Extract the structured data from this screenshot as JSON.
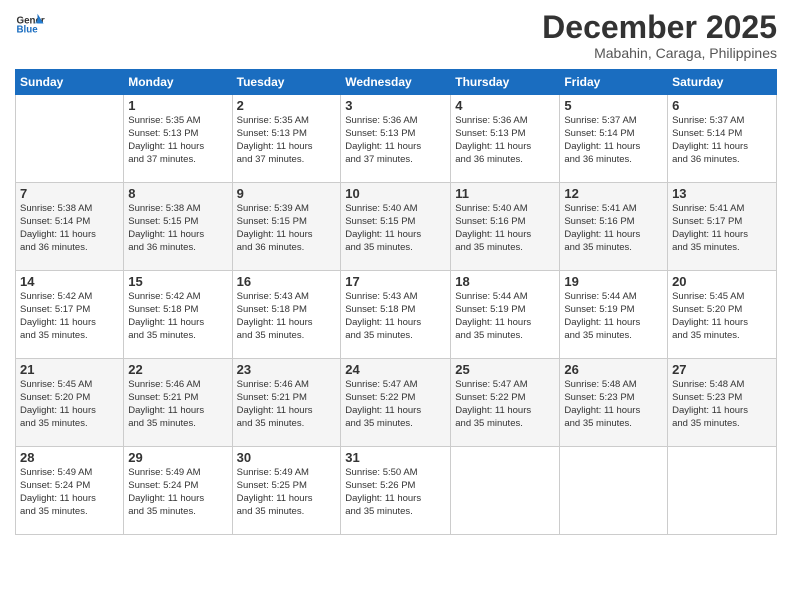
{
  "logo": {
    "general": "General",
    "blue": "Blue"
  },
  "header": {
    "month": "December 2025",
    "location": "Mabahin, Caraga, Philippines"
  },
  "weekdays": [
    "Sunday",
    "Monday",
    "Tuesday",
    "Wednesday",
    "Thursday",
    "Friday",
    "Saturday"
  ],
  "weeks": [
    [
      {
        "day": "",
        "info": ""
      },
      {
        "day": "1",
        "info": "Sunrise: 5:35 AM\nSunset: 5:13 PM\nDaylight: 11 hours\nand 37 minutes."
      },
      {
        "day": "2",
        "info": "Sunrise: 5:35 AM\nSunset: 5:13 PM\nDaylight: 11 hours\nand 37 minutes."
      },
      {
        "day": "3",
        "info": "Sunrise: 5:36 AM\nSunset: 5:13 PM\nDaylight: 11 hours\nand 37 minutes."
      },
      {
        "day": "4",
        "info": "Sunrise: 5:36 AM\nSunset: 5:13 PM\nDaylight: 11 hours\nand 36 minutes."
      },
      {
        "day": "5",
        "info": "Sunrise: 5:37 AM\nSunset: 5:14 PM\nDaylight: 11 hours\nand 36 minutes."
      },
      {
        "day": "6",
        "info": "Sunrise: 5:37 AM\nSunset: 5:14 PM\nDaylight: 11 hours\nand 36 minutes."
      }
    ],
    [
      {
        "day": "7",
        "info": "Sunrise: 5:38 AM\nSunset: 5:14 PM\nDaylight: 11 hours\nand 36 minutes."
      },
      {
        "day": "8",
        "info": "Sunrise: 5:38 AM\nSunset: 5:15 PM\nDaylight: 11 hours\nand 36 minutes."
      },
      {
        "day": "9",
        "info": "Sunrise: 5:39 AM\nSunset: 5:15 PM\nDaylight: 11 hours\nand 36 minutes."
      },
      {
        "day": "10",
        "info": "Sunrise: 5:40 AM\nSunset: 5:15 PM\nDaylight: 11 hours\nand 35 minutes."
      },
      {
        "day": "11",
        "info": "Sunrise: 5:40 AM\nSunset: 5:16 PM\nDaylight: 11 hours\nand 35 minutes."
      },
      {
        "day": "12",
        "info": "Sunrise: 5:41 AM\nSunset: 5:16 PM\nDaylight: 11 hours\nand 35 minutes."
      },
      {
        "day": "13",
        "info": "Sunrise: 5:41 AM\nSunset: 5:17 PM\nDaylight: 11 hours\nand 35 minutes."
      }
    ],
    [
      {
        "day": "14",
        "info": "Sunrise: 5:42 AM\nSunset: 5:17 PM\nDaylight: 11 hours\nand 35 minutes."
      },
      {
        "day": "15",
        "info": "Sunrise: 5:42 AM\nSunset: 5:18 PM\nDaylight: 11 hours\nand 35 minutes."
      },
      {
        "day": "16",
        "info": "Sunrise: 5:43 AM\nSunset: 5:18 PM\nDaylight: 11 hours\nand 35 minutes."
      },
      {
        "day": "17",
        "info": "Sunrise: 5:43 AM\nSunset: 5:18 PM\nDaylight: 11 hours\nand 35 minutes."
      },
      {
        "day": "18",
        "info": "Sunrise: 5:44 AM\nSunset: 5:19 PM\nDaylight: 11 hours\nand 35 minutes."
      },
      {
        "day": "19",
        "info": "Sunrise: 5:44 AM\nSunset: 5:19 PM\nDaylight: 11 hours\nand 35 minutes."
      },
      {
        "day": "20",
        "info": "Sunrise: 5:45 AM\nSunset: 5:20 PM\nDaylight: 11 hours\nand 35 minutes."
      }
    ],
    [
      {
        "day": "21",
        "info": "Sunrise: 5:45 AM\nSunset: 5:20 PM\nDaylight: 11 hours\nand 35 minutes."
      },
      {
        "day": "22",
        "info": "Sunrise: 5:46 AM\nSunset: 5:21 PM\nDaylight: 11 hours\nand 35 minutes."
      },
      {
        "day": "23",
        "info": "Sunrise: 5:46 AM\nSunset: 5:21 PM\nDaylight: 11 hours\nand 35 minutes."
      },
      {
        "day": "24",
        "info": "Sunrise: 5:47 AM\nSunset: 5:22 PM\nDaylight: 11 hours\nand 35 minutes."
      },
      {
        "day": "25",
        "info": "Sunrise: 5:47 AM\nSunset: 5:22 PM\nDaylight: 11 hours\nand 35 minutes."
      },
      {
        "day": "26",
        "info": "Sunrise: 5:48 AM\nSunset: 5:23 PM\nDaylight: 11 hours\nand 35 minutes."
      },
      {
        "day": "27",
        "info": "Sunrise: 5:48 AM\nSunset: 5:23 PM\nDaylight: 11 hours\nand 35 minutes."
      }
    ],
    [
      {
        "day": "28",
        "info": "Sunrise: 5:49 AM\nSunset: 5:24 PM\nDaylight: 11 hours\nand 35 minutes."
      },
      {
        "day": "29",
        "info": "Sunrise: 5:49 AM\nSunset: 5:24 PM\nDaylight: 11 hours\nand 35 minutes."
      },
      {
        "day": "30",
        "info": "Sunrise: 5:49 AM\nSunset: 5:25 PM\nDaylight: 11 hours\nand 35 minutes."
      },
      {
        "day": "31",
        "info": "Sunrise: 5:50 AM\nSunset: 5:26 PM\nDaylight: 11 hours\nand 35 minutes."
      },
      {
        "day": "",
        "info": ""
      },
      {
        "day": "",
        "info": ""
      },
      {
        "day": "",
        "info": ""
      }
    ]
  ]
}
